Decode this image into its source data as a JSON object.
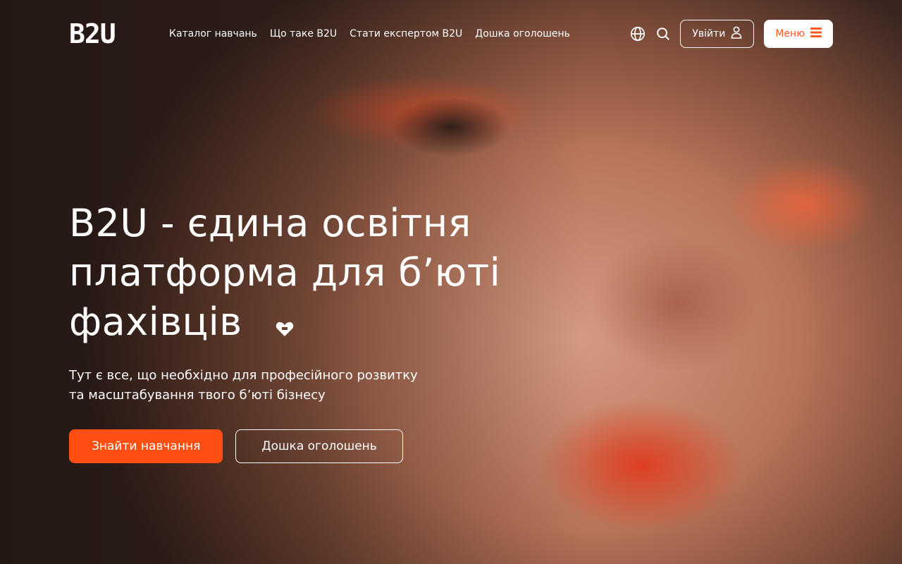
{
  "header": {
    "logo": "B2U",
    "nav": [
      {
        "label": "Каталог навчань"
      },
      {
        "label": "Що таке B2U"
      },
      {
        "label": "Стати експертом B2U"
      },
      {
        "label": "Дошка оголошень"
      }
    ],
    "login_label": "Увійти",
    "menu_label": "Меню"
  },
  "hero": {
    "title_line1": "B2U - єдина освітня",
    "title_line2": "платформа для б’юті",
    "title_line3": "фахівців",
    "subtitle_line1": "Тут є все, що необхідно для професійного розвитку",
    "subtitle_line2": "та масштабування твого б’юті бізнесу",
    "primary_button": "Знайти навчання",
    "secondary_button": "Дошка оголошень"
  },
  "colors": {
    "accent": "#ff4f12",
    "menu_text": "#ff5a1f"
  },
  "icons": {
    "language": "globe-icon",
    "search": "search-icon",
    "user": "user-icon",
    "menu": "hamburger-icon",
    "title_decoration": "heart-icon"
  }
}
